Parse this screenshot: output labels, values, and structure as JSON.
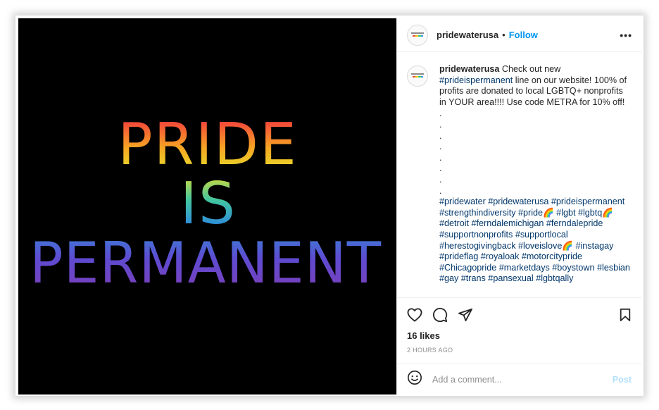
{
  "image": {
    "line1": "PRIDE",
    "line2": "IS",
    "line3": "PERMANENT",
    "background": "#000000",
    "gradient": [
      "#f4433b",
      "#f6a623",
      "#e6df2b",
      "#43c6a0",
      "#2f8fd8",
      "#5e4bd1",
      "#7b3fb8"
    ]
  },
  "header": {
    "username": "pridewaterusa",
    "separator": "•",
    "follow_label": "Follow",
    "more_label": "•••"
  },
  "caption": {
    "username": "pridewaterusa",
    "text_before_tag": " Check out new ",
    "tag_first": "#prideispermanent",
    "text_after_tag": " line on our website! 100% of profits are donated to local LGBTQ+ nonprofits in YOUR area!!!! Use code METRA for 10% off!",
    "dot_lines": [
      ".",
      ".",
      ".",
      ".",
      ".",
      ".",
      ".",
      "."
    ],
    "hashtags": "#pridewater #pridewaterusa #prideispermanent #strengthindiversity #pride🌈 #lgbt #lgbtq🌈 #detroit #ferndalemichigan #ferndalepride #supportnonprofits #supportlocal #herestogivingback #loveislove🌈 #instagay #prideflag #royaloak #motorcitypride #Chicagopride #marketdays #boystown #lesbian #gay #trans #pansexual #lgbtqally"
  },
  "actions": {
    "icons": [
      "heart-icon",
      "comment-icon",
      "share-icon",
      "bookmark-icon"
    ],
    "likes": "16 likes",
    "time": "2 HOURS AGO"
  },
  "comment": {
    "placeholder": "Add a comment...",
    "post_label": "Post",
    "emoji_icon": "smiley-icon"
  },
  "colors": {
    "follow": "#0095f6",
    "hashtag": "#00376b",
    "post_disabled": "#b2dffc"
  }
}
